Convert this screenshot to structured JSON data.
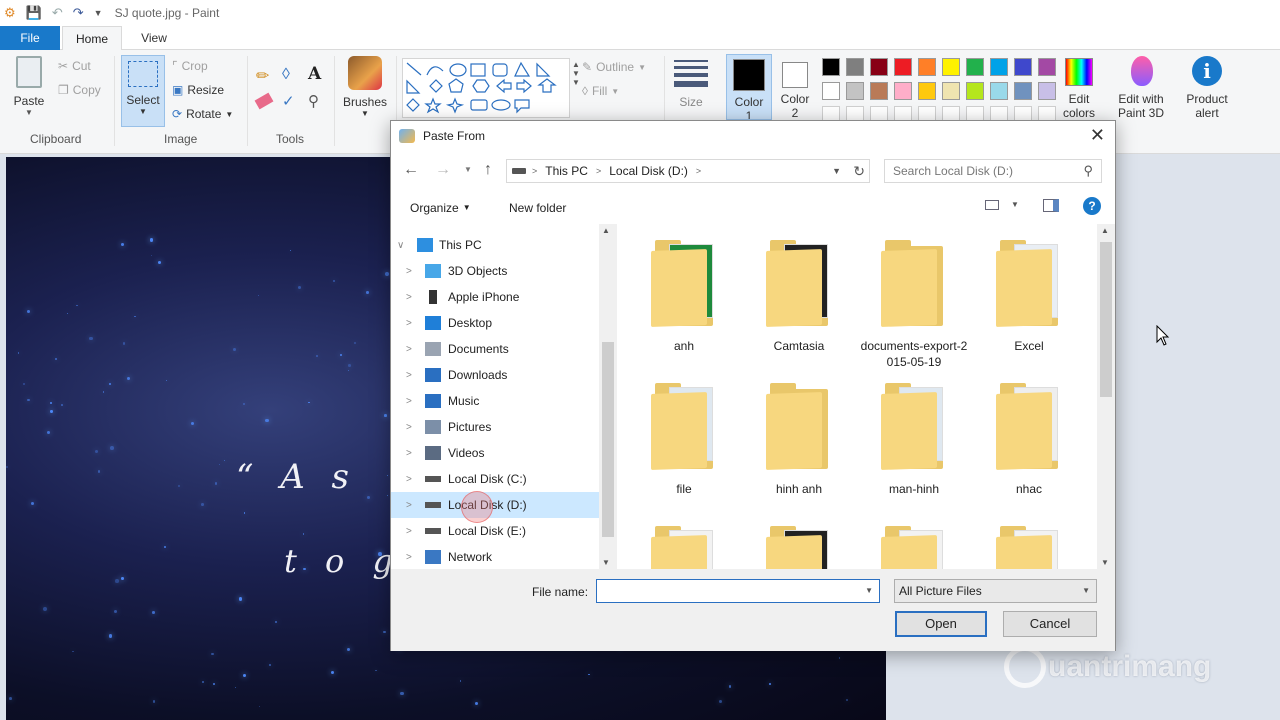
{
  "window": {
    "title": "SJ quote.jpg - Paint"
  },
  "menu_tabs": {
    "file": "File",
    "home": "Home",
    "view": "View"
  },
  "ribbon": {
    "clipboard": {
      "paste": "Paste",
      "cut": "Cut",
      "copy": "Copy",
      "label": "Clipboard"
    },
    "image": {
      "select": "Select",
      "crop": "Crop",
      "resize": "Resize",
      "rotate": "Rotate",
      "label": "Image"
    },
    "tools": {
      "label": "Tools"
    },
    "brushes": "Brushes",
    "shapes": {
      "outline": "Outline",
      "fill": "Fill"
    },
    "size": "Size",
    "color1": "Color 1",
    "color2": "Color 2",
    "edit_colors": "Edit colors",
    "edit_paint3d": "Edit with Paint 3D",
    "product_alert": "Product alert",
    "palette": [
      "#000000",
      "#7f7f7f",
      "#880015",
      "#ed1c24",
      "#ff7f27",
      "#fff200",
      "#22b14c",
      "#00a2e8",
      "#3f48cc",
      "#a349a4",
      "#ffffff",
      "#c3c3c3",
      "#b97a57",
      "#ffaec9",
      "#ffc90e",
      "#efe4b0",
      "#b5e61d",
      "#99d9ea",
      "#7092be",
      "#c8bfe7"
    ]
  },
  "canvas": {
    "quote_line1": "“ A s",
    "quote_line2": "t o g e"
  },
  "dialog": {
    "title": "Paste From",
    "path": [
      "This PC",
      "Local Disk (D:)"
    ],
    "search_placeholder": "Search Local Disk (D:)",
    "organize": "Organize",
    "new_folder": "New folder",
    "nav": [
      {
        "label": "This PC",
        "icon": "pc-icon"
      },
      {
        "label": "3D Objects",
        "icon": "3d-objects-icon"
      },
      {
        "label": "Apple iPhone",
        "icon": "phone-icon"
      },
      {
        "label": "Desktop",
        "icon": "desktop-icon"
      },
      {
        "label": "Documents",
        "icon": "documents-icon"
      },
      {
        "label": "Downloads",
        "icon": "downloads-icon"
      },
      {
        "label": "Music",
        "icon": "music-icon"
      },
      {
        "label": "Pictures",
        "icon": "pictures-icon"
      },
      {
        "label": "Videos",
        "icon": "videos-icon"
      },
      {
        "label": "Local Disk (C:)",
        "icon": "drive-icon"
      },
      {
        "label": "Local Disk (D:)",
        "icon": "drive-icon"
      },
      {
        "label": "Local Disk (E:)",
        "icon": "drive-icon"
      },
      {
        "label": "Network",
        "icon": "network-icon"
      }
    ],
    "files": [
      {
        "name": "anh"
      },
      {
        "name": "Camtasia"
      },
      {
        "name": "documents-export-2015-05-19"
      },
      {
        "name": "Excel"
      },
      {
        "name": "file"
      },
      {
        "name": "hinh anh"
      },
      {
        "name": "man-hinh"
      },
      {
        "name": "nhac"
      }
    ],
    "file_name_label": "File name:",
    "file_name_value": "",
    "file_type": "All Picture Files",
    "open": "Open",
    "cancel": "Cancel"
  },
  "watermark": "uantrimang"
}
